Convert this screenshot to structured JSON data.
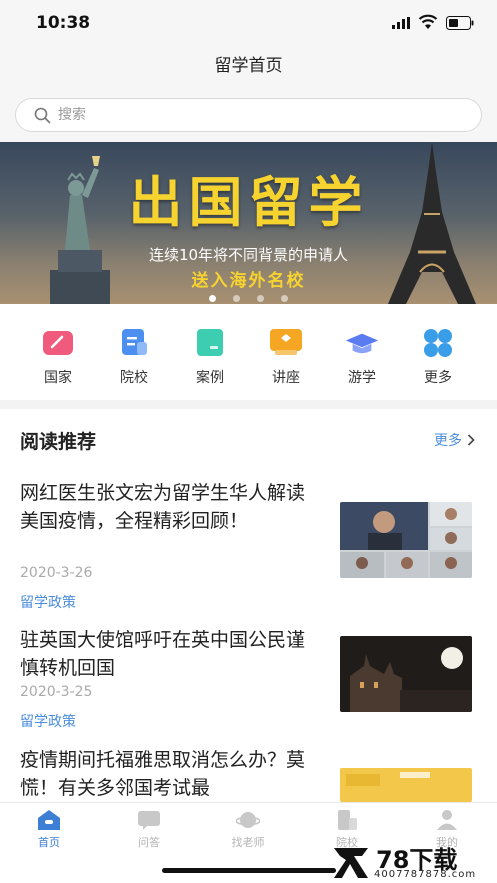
{
  "status": {
    "time": "10:38"
  },
  "nav": {
    "title": "留学首页"
  },
  "search": {
    "placeholder": "搜索"
  },
  "banner": {
    "headline": "出国留学",
    "subtitle": "连续10年将不同背景的申请人",
    "tagline": "送入海外名校",
    "dots": 4,
    "active_dot": 0
  },
  "quick_links": [
    {
      "label": "国家",
      "icon": "country-icon",
      "color": "#ef5a7d"
    },
    {
      "label": "院校",
      "icon": "school-icon",
      "color": "#4d8ff0"
    },
    {
      "label": "案例",
      "icon": "case-icon",
      "color": "#3dcdb0"
    },
    {
      "label": "讲座",
      "icon": "lecture-icon",
      "color": "#f5a623"
    },
    {
      "label": "游学",
      "icon": "graduation-cap-icon",
      "color": "#5b7bf0"
    },
    {
      "label": "更多",
      "icon": "more-grid-icon",
      "color": "#3a9de8"
    }
  ],
  "section": {
    "title": "阅读推荐",
    "more": "更多"
  },
  "articles": [
    {
      "title": "网红医生张文宏为留学生华人解读美国疫情，全程精彩回顾！",
      "date": "2020-3-26",
      "tag": "留学政策"
    },
    {
      "title": "驻英国大使馆呼吁在英中国公民谨慎转机回国",
      "date": "2020-3-25",
      "tag": "留学政策"
    },
    {
      "title": "疫情期间托福雅思取消怎么办？莫慌！有关多邻国考试最",
      "date": "",
      "tag": ""
    }
  ],
  "tabs": [
    {
      "label": "首页",
      "icon": "home-icon",
      "active": true
    },
    {
      "label": "问答",
      "icon": "chat-icon",
      "active": false
    },
    {
      "label": "找老师",
      "icon": "planet-icon",
      "active": false
    },
    {
      "label": "院校",
      "icon": "building-icon",
      "active": false
    },
    {
      "label": "我的",
      "icon": "person-icon",
      "active": false
    }
  ],
  "watermark": {
    "big": "78下载",
    "small": "4007787878.com"
  },
  "colors": {
    "accent": "#3e7fd6",
    "link": "#4c8edc",
    "banner_text": "#f7d32f"
  }
}
